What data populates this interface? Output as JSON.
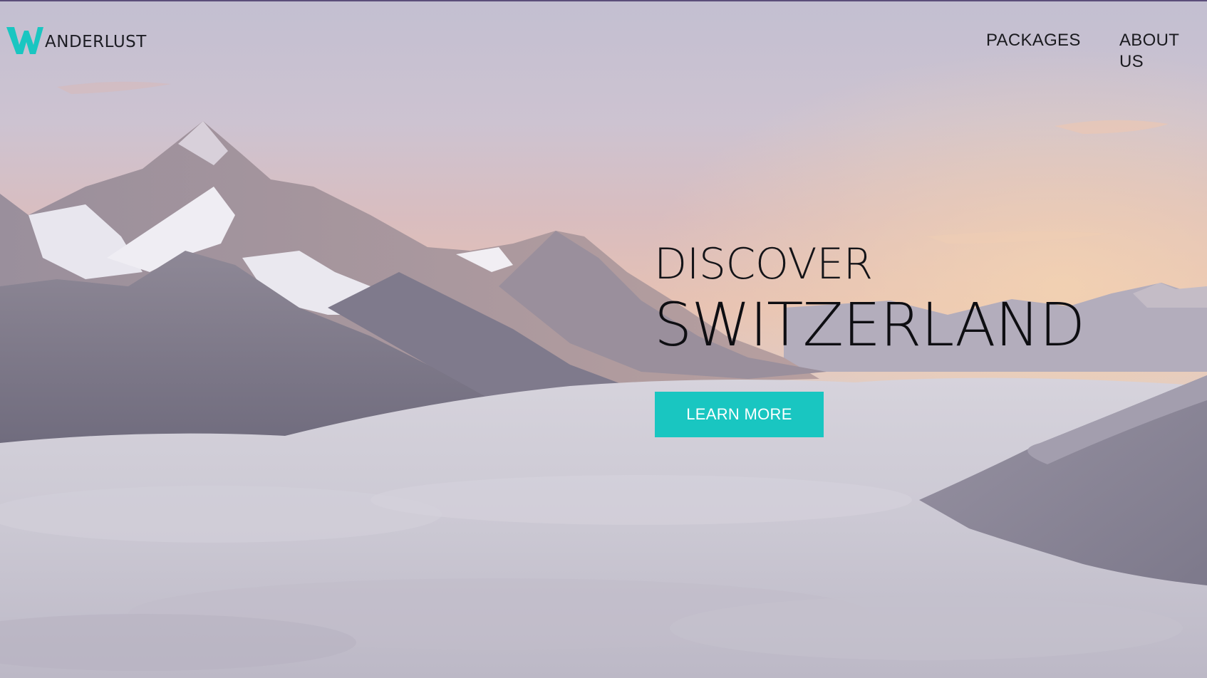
{
  "brand": {
    "logo_letter": "W",
    "logo_rest": "ANDERLUST",
    "accent_color": "#19c6c1"
  },
  "nav": {
    "items": [
      {
        "label": "PACKAGES"
      },
      {
        "label": "ABOUT US"
      }
    ]
  },
  "hero": {
    "line1": "DISCOVER",
    "line2": "SWITZERLAND",
    "cta_label": "LEARN MORE",
    "background_image": "mountains-above-clouds-sunrise"
  }
}
